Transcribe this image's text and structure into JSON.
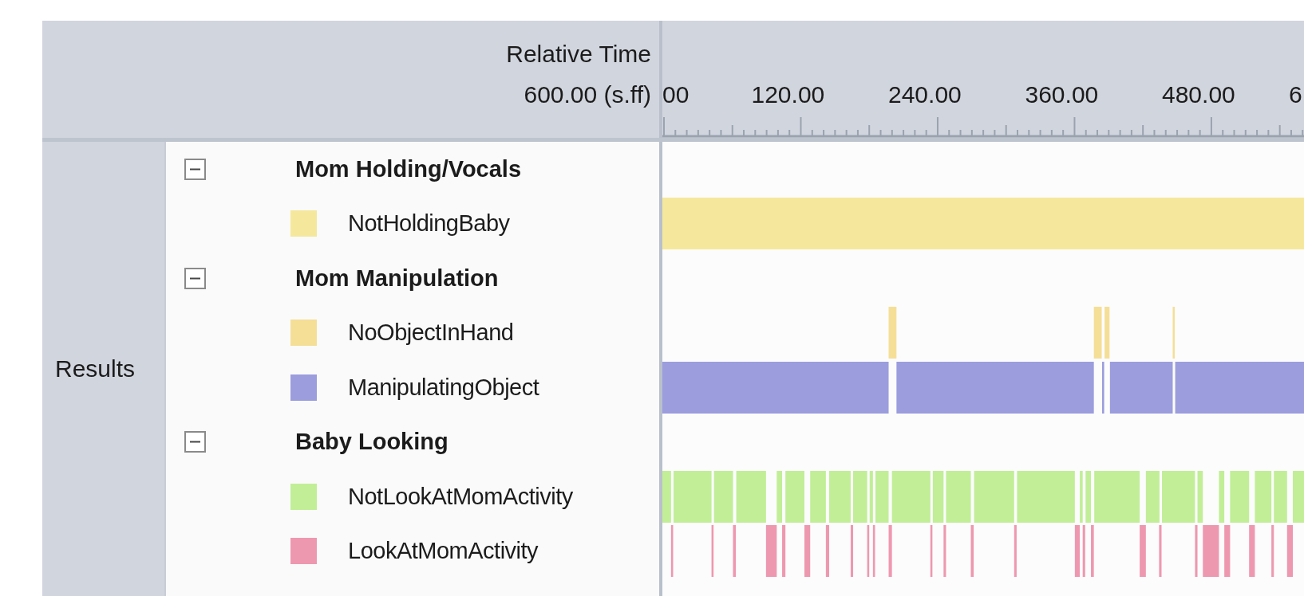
{
  "header": {
    "title": "Relative Time",
    "duration": "600.00 (s.ff)",
    "ticks": [
      "00",
      "120.00",
      "240.00",
      "360.00",
      "480.00",
      "6"
    ]
  },
  "section": {
    "label": "Results"
  },
  "groups": [
    {
      "name": "Mom Holding/Vocals",
      "expanded": true,
      "codes": [
        {
          "name": "NotHoldingBaby",
          "color": "#f5e89c"
        }
      ]
    },
    {
      "name": "Mom Manipulation",
      "expanded": true,
      "codes": [
        {
          "name": "NoObjectInHand",
          "color": "#f5df97"
        },
        {
          "name": "ManipulatingObject",
          "color": "#9b9ddd"
        }
      ]
    },
    {
      "name": "Baby Looking",
      "expanded": true,
      "codes": [
        {
          "name": "NotLookAtMomActivity",
          "color": "#c1ee97"
        },
        {
          "name": "LookAtMomActivity",
          "color": "#ee98b0"
        }
      ]
    }
  ]
}
